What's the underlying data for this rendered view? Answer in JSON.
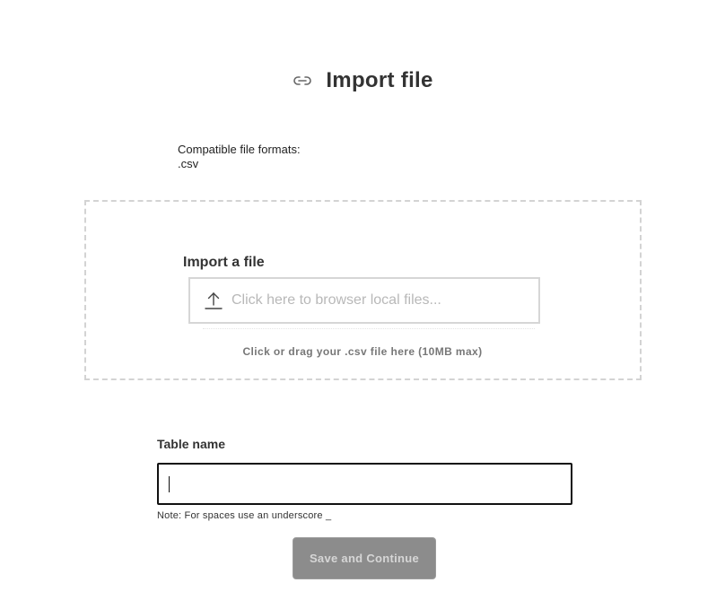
{
  "header": {
    "title": "Import file",
    "icon": "link-icon"
  },
  "formats": {
    "label": "Compatible file formats:",
    "value": ".csv"
  },
  "upload": {
    "label": "Import a file",
    "placeholder": "Click here to browser local files...",
    "icon": "upload-icon",
    "hint": "Click or drag your .csv file here (10MB max)"
  },
  "table": {
    "label": "Table name",
    "value": "",
    "note": "Note: For spaces use an underscore _"
  },
  "actions": {
    "save_label": "Save and Continue"
  }
}
